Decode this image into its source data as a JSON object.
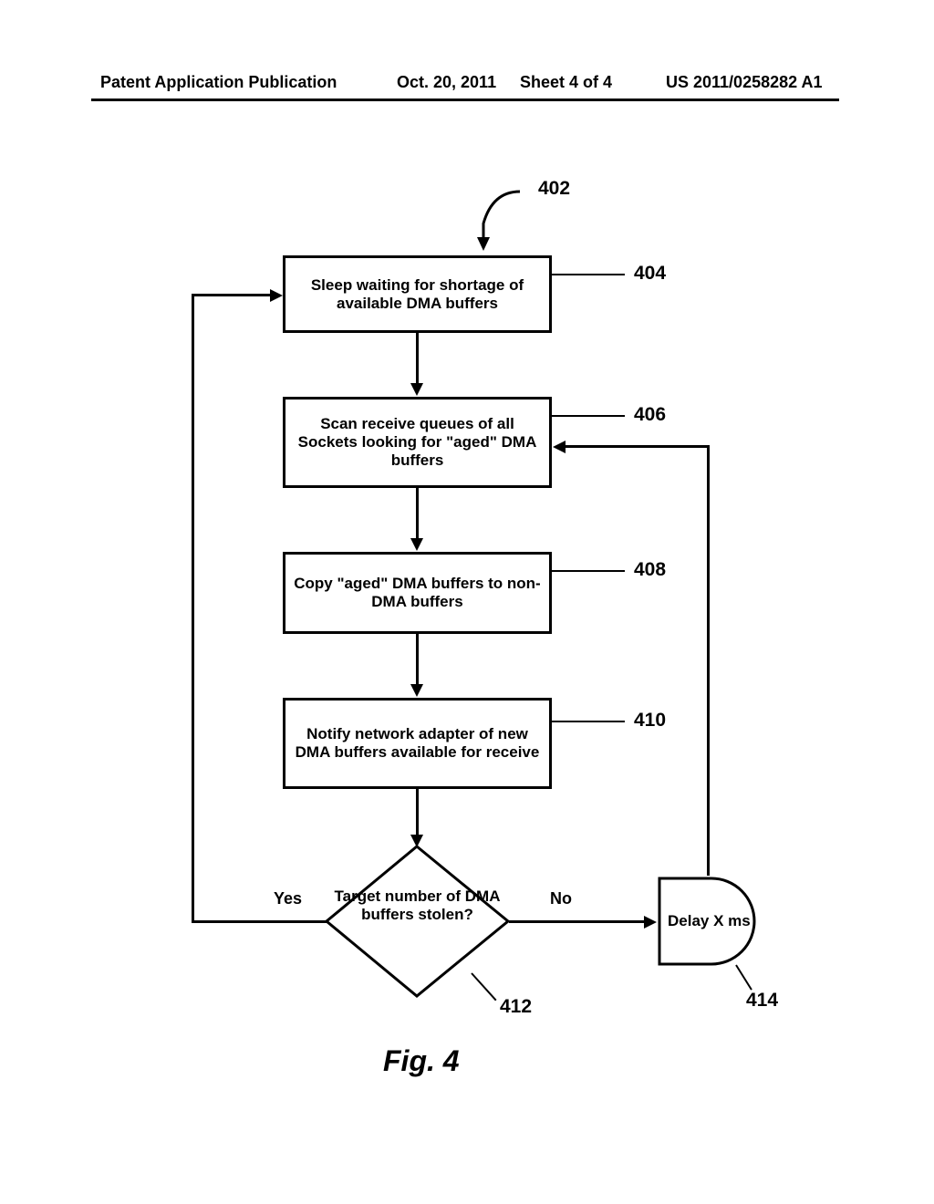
{
  "header": {
    "left": "Patent Application Publication",
    "date": "Oct. 20, 2011",
    "sheet": "Sheet 4 of 4",
    "right": "US 2011/0258282 A1"
  },
  "labels": {
    "l402": "402",
    "l404": "404",
    "l406": "406",
    "l408": "408",
    "l410": "410",
    "l412": "412",
    "l414": "414"
  },
  "boxes": {
    "step404": "Sleep waiting for shortage of available DMA buffers",
    "step406": "Scan receive queues of all Sockets looking for \"aged\" DMA buffers",
    "step408": "Copy \"aged\" DMA buffers to non-DMA buffers",
    "step410": "Notify network adapter of new DMA buffers available for receive",
    "decision412": "Target number of DMA buffers stolen?",
    "delay414": "Delay X ms"
  },
  "branches": {
    "yes": "Yes",
    "no": "No"
  },
  "caption": "Fig. 4",
  "chart_data": {
    "type": "flowchart",
    "nodes": [
      {
        "id": "402",
        "type": "start",
        "label": ""
      },
      {
        "id": "404",
        "type": "process",
        "label": "Sleep waiting for shortage of available DMA buffers"
      },
      {
        "id": "406",
        "type": "process",
        "label": "Scan receive queues of all Sockets looking for \"aged\" DMA buffers"
      },
      {
        "id": "408",
        "type": "process",
        "label": "Copy \"aged\" DMA buffers to non-DMA buffers"
      },
      {
        "id": "410",
        "type": "process",
        "label": "Notify network adapter of new DMA buffers available for receive"
      },
      {
        "id": "412",
        "type": "decision",
        "label": "Target number of DMA buffers stolen?"
      },
      {
        "id": "414",
        "type": "delay",
        "label": "Delay X ms"
      }
    ],
    "edges": [
      {
        "from": "402",
        "to": "404"
      },
      {
        "from": "404",
        "to": "406"
      },
      {
        "from": "406",
        "to": "408"
      },
      {
        "from": "408",
        "to": "410"
      },
      {
        "from": "410",
        "to": "412"
      },
      {
        "from": "412",
        "to": "404",
        "label": "Yes"
      },
      {
        "from": "412",
        "to": "414",
        "label": "No"
      },
      {
        "from": "414",
        "to": "406"
      }
    ]
  }
}
